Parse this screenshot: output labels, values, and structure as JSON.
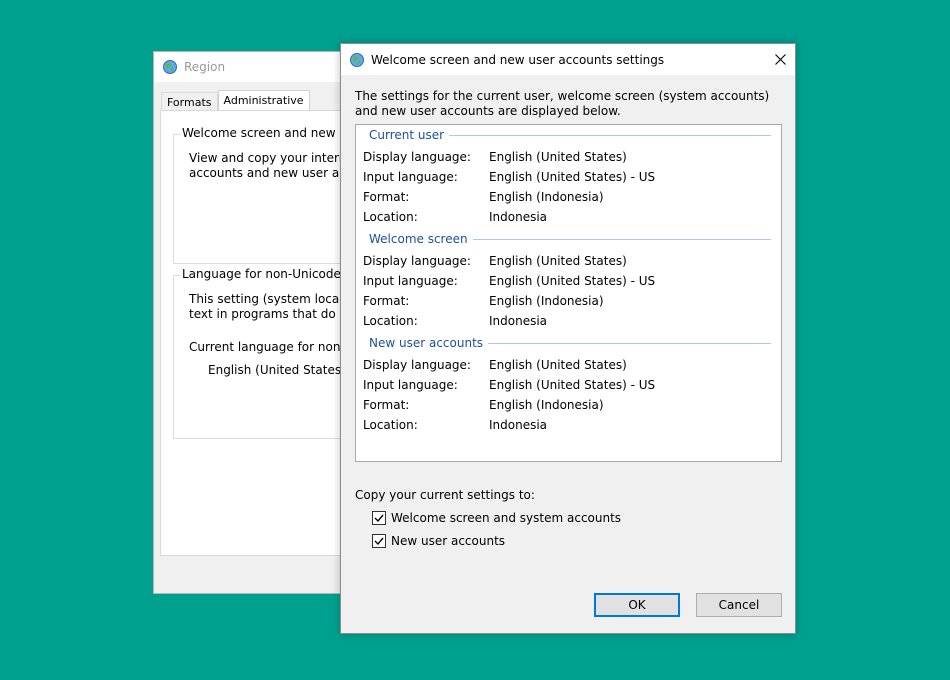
{
  "colors": {
    "desktop": "#00A08F",
    "section_heading": "#1E4E9E",
    "default_button_border": "#0078D7"
  },
  "region_window": {
    "title": "Region",
    "icon": "globe-icon",
    "tabs": [
      {
        "label": "Formats"
      },
      {
        "label": "Administrative"
      }
    ],
    "welcome_group": {
      "legend": "Welcome screen and new user",
      "text": "View and copy your internati\naccounts and new user accou"
    },
    "nonunicode_group": {
      "legend": "Language for non-Unicode pr",
      "text": "This setting (system locale) c\ntext in programs that do not",
      "current_label": "Current language for non-U",
      "current_value": "English (United States)"
    }
  },
  "dialog": {
    "title": "Welcome screen and new user accounts settings",
    "icon": "globe-icon",
    "intro": "The settings for the current user, welcome screen (system accounts) and new user accounts are displayed below.",
    "sections": [
      {
        "heading": "Current user",
        "rows": [
          {
            "label": "Display language:",
            "value": "English (United States)"
          },
          {
            "label": "Input language:",
            "value": "English (United States) - US"
          },
          {
            "label": "Format:",
            "value": "English (Indonesia)"
          },
          {
            "label": "Location:",
            "value": "Indonesia"
          }
        ]
      },
      {
        "heading": "Welcome screen",
        "rows": [
          {
            "label": "Display language:",
            "value": "English (United States)"
          },
          {
            "label": "Input language:",
            "value": "English (United States) - US"
          },
          {
            "label": "Format:",
            "value": "English (Indonesia)"
          },
          {
            "label": "Location:",
            "value": "Indonesia"
          }
        ]
      },
      {
        "heading": "New user accounts",
        "rows": [
          {
            "label": "Display language:",
            "value": "English (United States)"
          },
          {
            "label": "Input language:",
            "value": "English (United States) - US"
          },
          {
            "label": "Format:",
            "value": "English (Indonesia)"
          },
          {
            "label": "Location:",
            "value": "Indonesia"
          }
        ]
      }
    ],
    "copy_label": "Copy your current settings to:",
    "checkboxes": [
      {
        "label": "Welcome screen and system accounts",
        "checked": true
      },
      {
        "label": "New user accounts",
        "checked": true
      }
    ],
    "ok_label": "OK",
    "cancel_label": "Cancel"
  }
}
